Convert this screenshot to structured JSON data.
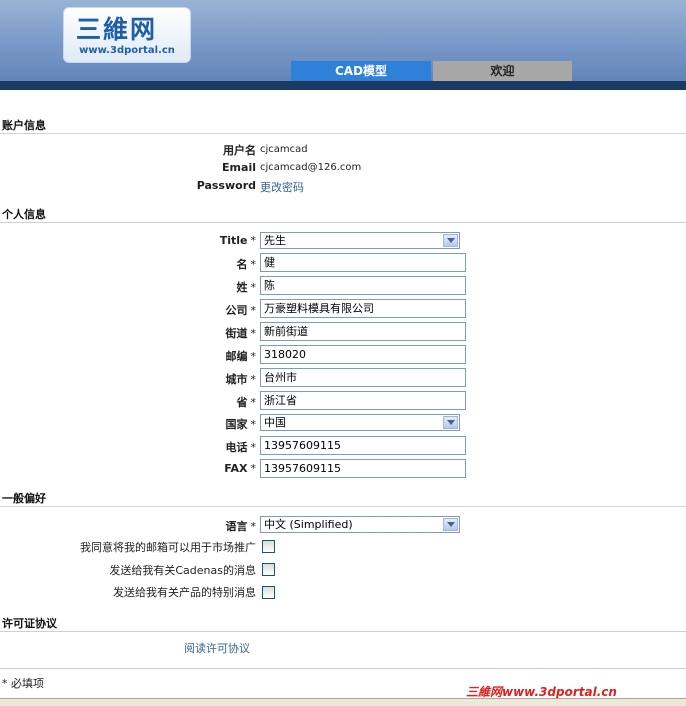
{
  "header": {
    "logo_main": "三維网",
    "logo_url": "www.3dportal.cn",
    "tabs": [
      {
        "label": "CAD模型"
      },
      {
        "label": "欢迎"
      }
    ]
  },
  "account": {
    "title": "账户信息",
    "username_label": "用户名",
    "username": "cjcamcad",
    "email_label": "Email",
    "email": "cjcamcad@126.com",
    "password_label": "Password",
    "password_link": "更改密码"
  },
  "personal": {
    "title": "个人信息",
    "required_mark": "*",
    "fields": [
      {
        "label": "Title",
        "value": "先生"
      },
      {
        "label": "名",
        "value": "健"
      },
      {
        "label": "姓",
        "value": "陈"
      },
      {
        "label": "公司",
        "value": "万豪塑料模具有限公司"
      },
      {
        "label": "街道",
        "value": "新前街道"
      },
      {
        "label": "邮编",
        "value": "318020"
      },
      {
        "label": "城市",
        "value": "台州市"
      },
      {
        "label": "省",
        "value": "浙江省"
      },
      {
        "label": "国家",
        "value": "中国"
      },
      {
        "label": "电话",
        "value": "13957609115"
      },
      {
        "label": "FAX",
        "value": "13957609115"
      }
    ]
  },
  "preferences": {
    "title": "一般偏好",
    "language_label": "语言",
    "language_value": "中文 (Simplified)",
    "checkboxes": [
      {
        "label": "我同意将我的邮箱可以用于市场推广"
      },
      {
        "label": "发送给我有关Cadenas的消息"
      },
      {
        "label": "发送给我有关产品的特别消息"
      }
    ]
  },
  "license": {
    "title": "许可证协议",
    "read_link": "阅读许可协议"
  },
  "footer": {
    "required_note": "* 必填项",
    "watermark": "三維网www.3dportal.cn"
  },
  "colors": {
    "active_tab": "#2f80d8",
    "inactive_tab": "#a7a7a7",
    "header_dark": "#1b3a63",
    "link": "#336699"
  }
}
